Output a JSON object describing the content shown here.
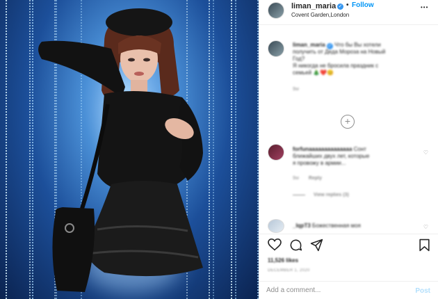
{
  "post": {
    "username": "liman_maria",
    "verified_symbol": "✓",
    "follow_separator": "•",
    "follow_label": "Follow",
    "location": "Covent Garden,London",
    "more_label": "•••"
  },
  "caption": {
    "username": "liman_maria",
    "text_line1": "Что бы Вы хотели",
    "text_line2": "получить от Деда Мороза на Новый",
    "text_line3": "Год?",
    "text_line4": "Я никогда не бросила праздник с",
    "text_line5": "семьей 🎄❤️😊",
    "age": "9w"
  },
  "comments": [
    {
      "username": "forfunaaaaaaaaaaaaaa",
      "text_line1": "Сонт",
      "text_line2": "ближайших двух лет, которые",
      "text_line3": "я провожу в армии...",
      "age": "9w",
      "reply_label": "Reply",
      "view_replies": "View replies (3)"
    },
    {
      "username": "_lqpT3",
      "text": "Божественная моя"
    }
  ],
  "actions": {
    "like_icon": "heart-icon",
    "comment_icon": "comment-icon",
    "share_icon": "share-icon",
    "save_icon": "bookmark-icon"
  },
  "likes": "11,526 likes",
  "date": "DECEMBER 1, 2020",
  "add_comment": {
    "placeholder": "Add a comment...",
    "post_label": "Post"
  },
  "colors": {
    "link": "#0095f6",
    "verified": "#3897f0",
    "text": "#262626",
    "muted": "#8e8e8e"
  }
}
